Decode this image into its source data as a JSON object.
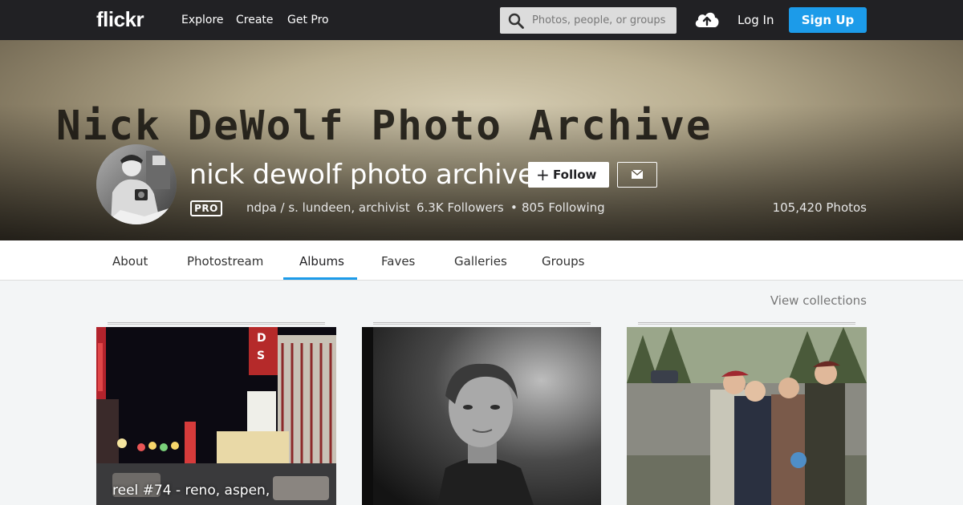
{
  "topnav": {
    "logo": "flickr",
    "links": [
      "Explore",
      "Create",
      "Get Pro"
    ],
    "search_placeholder": "Photos, people, or groups",
    "login": "Log In",
    "signup": "Sign Up",
    "icons": [
      "search-icon",
      "upload-cloud-icon"
    ]
  },
  "profile": {
    "cover_text": "Nick DeWolf Photo Archive",
    "name": "nick dewolf photo archive",
    "follow_label": "Follow",
    "pro_badge": "PRO",
    "realname": "ndpa / s. lundeen, archivist",
    "followers": "6.3K Followers",
    "following": "805 Following",
    "separator": "•",
    "photo_count": "105,420 Photos"
  },
  "subnav": {
    "tabs": [
      "About",
      "Photostream",
      "Albums",
      "Faves",
      "Galleries",
      "Groups"
    ],
    "active": "Albums"
  },
  "view_collections": "View collections",
  "albums": [
    {
      "title": "reel #74 - reno, aspen,"
    },
    {
      "title": ""
    },
    {
      "title": ""
    }
  ],
  "colors": {
    "topbar": "#212124",
    "accent": "#1c9be9",
    "page_bg": "#f3f5f6"
  }
}
